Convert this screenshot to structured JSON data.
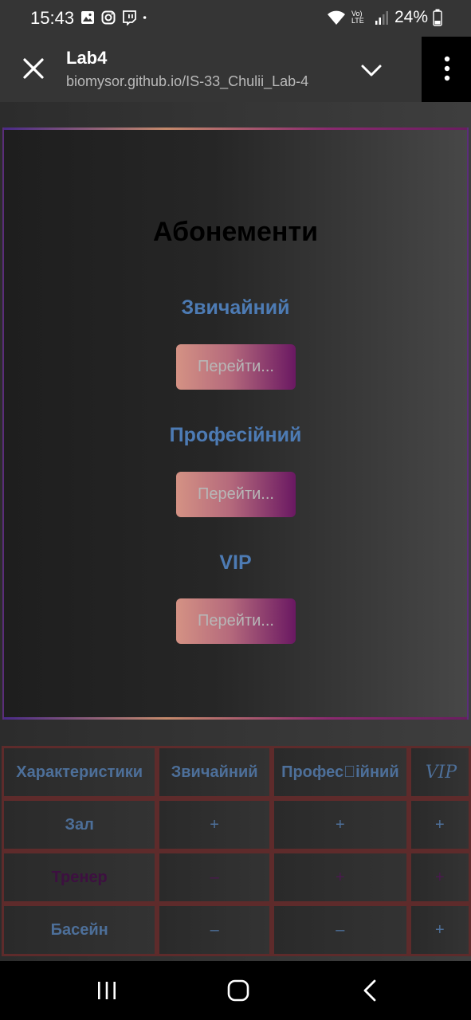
{
  "status_bar": {
    "time": "15:43",
    "battery": "24%",
    "network": "Vo) LTE"
  },
  "toolbar": {
    "title": "Lab4",
    "url": "biomysor.github.io/IS-33_Chulii_Lab-4"
  },
  "card": {
    "title": "Абонементи",
    "plans": [
      {
        "name": "Звичайний",
        "button": "Перейти..."
      },
      {
        "name": "Професійний",
        "button": "Перейти..."
      },
      {
        "name": "VIP",
        "button": "Перейти..."
      }
    ]
  },
  "table": {
    "headers": [
      "Характеристики",
      "Звичайний",
      "Профес\u0000ійний",
      "VIP"
    ],
    "rows": [
      {
        "label": "Зал",
        "cells": [
          "+",
          "+",
          "+"
        ]
      },
      {
        "label": "Тренер",
        "cells": [
          "–",
          "+",
          "+"
        ]
      },
      {
        "label": "Басейн",
        "cells": [
          "–",
          "–",
          "+"
        ]
      }
    ]
  },
  "colors": {
    "accent_blue": "#4d7bb4",
    "button_gradient_start": "#d49284",
    "button_gradient_end": "#6a1862",
    "table_border": "#5e2b2b"
  }
}
